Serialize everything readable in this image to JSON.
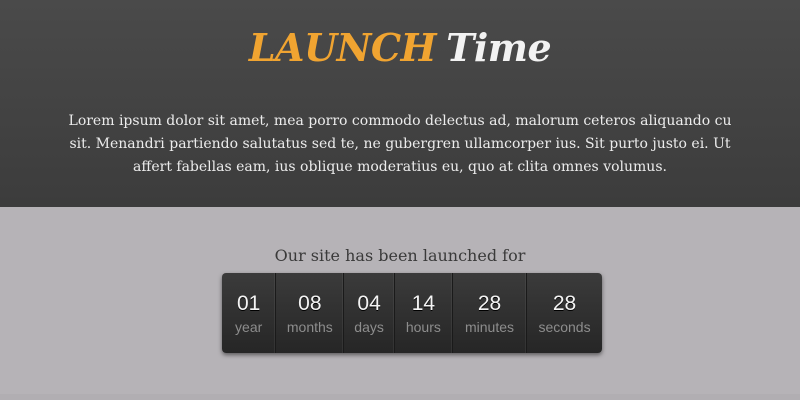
{
  "logo": {
    "word1": "LAUNCH",
    "word2": "Time"
  },
  "intro": {
    "text": "Lorem ipsum dolor sit amet, mea porro commodo delectus ad, malorum ceteros aliquando cu sit. Menandri partiendo salutatus sed te, ne gubergren ullamcorper ius. Sit purto justo ei. Ut affert fabellas eam, ius oblique moderatius eu, quo at clita omnes volumus."
  },
  "countdown": {
    "heading": "Our site has been launched for",
    "units": [
      {
        "value": "01",
        "label": "year"
      },
      {
        "value": "08",
        "label": "months"
      },
      {
        "value": "04",
        "label": "days"
      },
      {
        "value": "14",
        "label": "hours"
      },
      {
        "value": "28",
        "label": "minutes"
      },
      {
        "value": "28",
        "label": "seconds"
      }
    ]
  },
  "colors": {
    "accent": "#f0a431",
    "header_bg": "#424242",
    "body_bg": "#b6b3b7",
    "counter_bg": "#2e2e2e"
  }
}
